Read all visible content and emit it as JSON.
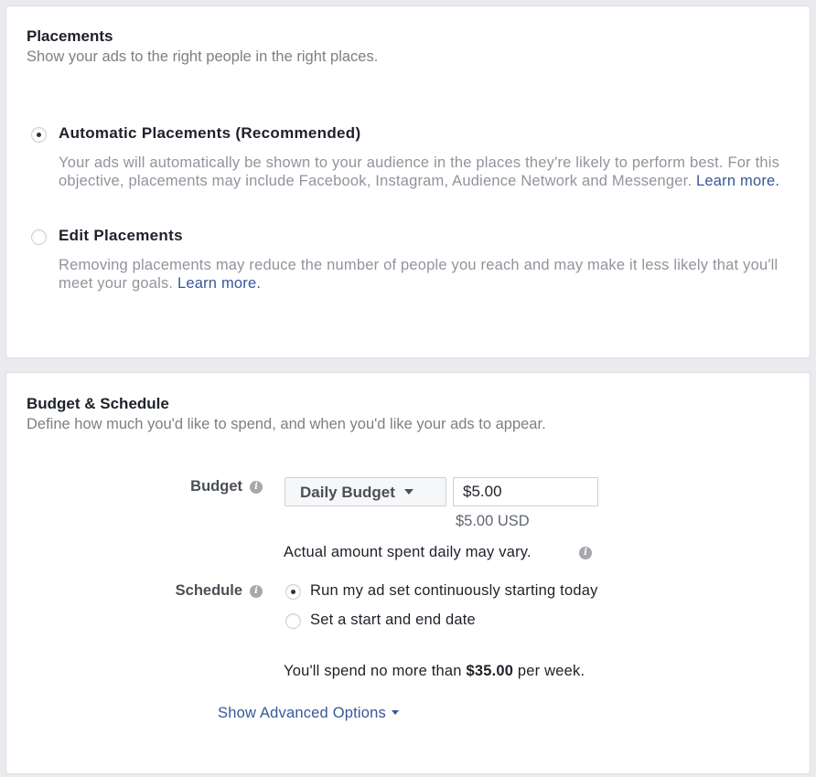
{
  "placements": {
    "title": "Placements",
    "subtitle": "Show your ads to the right people in the right places.",
    "options": [
      {
        "label": "Automatic Placements (Recommended)",
        "selected": true,
        "description": "Your ads will automatically be shown to your audience in the places they're likely to perform best. For this objective, placements may include Facebook, Instagram, Audience Network and Messenger.",
        "link": "Learn more."
      },
      {
        "label": "Edit Placements",
        "selected": false,
        "description": "Removing placements may reduce the number of people you reach and may make it less likely that you'll meet your goals.",
        "link": "Learn more."
      }
    ]
  },
  "budget_schedule": {
    "title": "Budget & Schedule",
    "subtitle": "Define how much you'd like to spend, and when you'd like your ads to appear.",
    "budget_label": "Budget",
    "budget_type": "Daily Budget",
    "budget_value": "$5.00",
    "budget_currency_note": "$5.00 USD",
    "daily_note": "Actual amount spent daily may vary.",
    "schedule_label": "Schedule",
    "schedule_options": [
      {
        "label": "Run my ad set continuously starting today",
        "selected": true
      },
      {
        "label": "Set a start and end date",
        "selected": false
      }
    ],
    "spend_prefix": "You'll spend no more than ",
    "spend_amount": "$35.00",
    "spend_suffix": " per week.",
    "advanced_link": "Show Advanced Options"
  },
  "icons": {
    "info": "info-icon",
    "dropdown": "caret-down-icon"
  },
  "colors": {
    "link": "#365899",
    "background": "#e9ebee"
  }
}
